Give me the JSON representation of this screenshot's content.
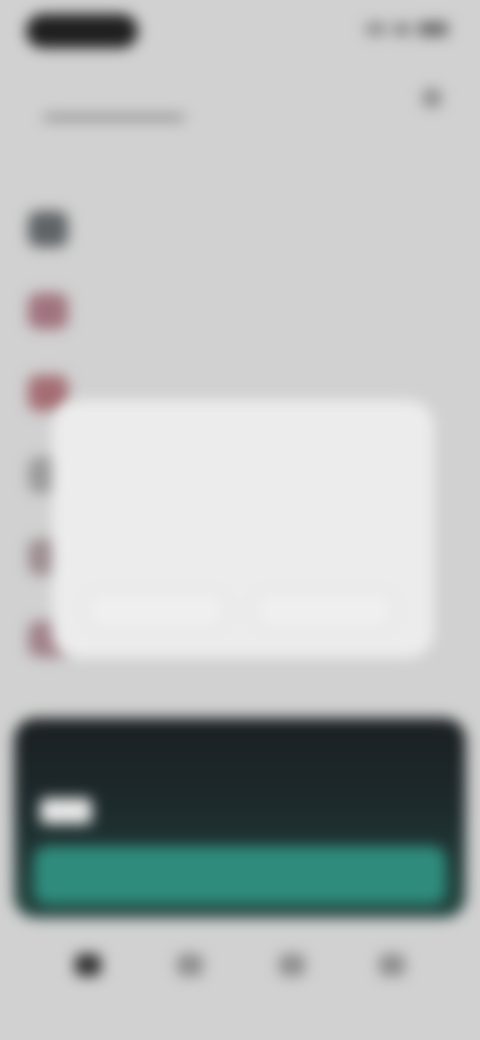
{
  "status_bar": {
    "time": "",
    "icons": [
      "signal-icon",
      "wifi-icon",
      "battery-icon"
    ]
  },
  "tabs": [
    {
      "label": "",
      "active": true
    },
    {
      "label": "",
      "active": false
    }
  ],
  "section_heading": "",
  "list_items": [
    {
      "title": "",
      "subtitle": "",
      "avatar_color": "#5f6366"
    },
    {
      "title": "",
      "subtitle": "",
      "avatar_color": "#a0737e"
    },
    {
      "title": "",
      "subtitle": "",
      "avatar_color": "#a46d73"
    },
    {
      "title": "",
      "subtitle": "",
      "avatar_color": "#9a9a9a"
    },
    {
      "title": "",
      "subtitle": "",
      "avatar_color": "#9c8d90"
    },
    {
      "title": "",
      "subtitle": "",
      "avatar_color": "#a0828a"
    }
  ],
  "promo": {
    "badge": "",
    "text": "",
    "button_label": "",
    "colors": {
      "button": "#2f8c7d",
      "card_top": "#1b1f22",
      "card_bottom": "#23463f"
    }
  },
  "bottom_nav": [
    {
      "label": "",
      "icon": "home-icon",
      "active": true
    },
    {
      "label": "",
      "icon": "explore-icon",
      "active": false
    },
    {
      "label": "",
      "icon": "library-icon",
      "active": false
    },
    {
      "label": "",
      "icon": "profile-icon",
      "active": false
    }
  ],
  "dialog": {
    "title": "",
    "body": "",
    "secondary_label": "",
    "primary_label": ""
  }
}
